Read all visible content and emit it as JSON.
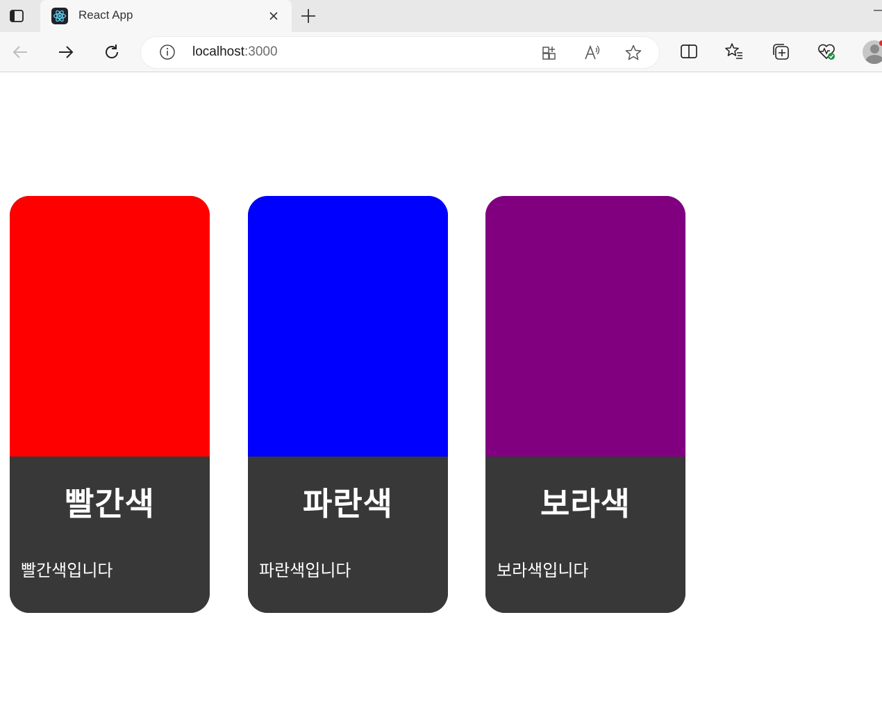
{
  "browser": {
    "tab": {
      "title": "React App",
      "favicon": "react-logo-icon"
    },
    "address": {
      "host": "localhost",
      "port": ":3000"
    },
    "icons": {
      "left": [
        "back-icon",
        "forward-icon",
        "refresh-icon"
      ],
      "address": [
        "site-info-icon",
        "apps-icon",
        "read-aloud-icon",
        "favorite-star-icon"
      ],
      "toolbar": [
        "split-screen-icon",
        "favorites-icon",
        "collections-icon",
        "browser-essentials-icon",
        "profile-icon"
      ]
    }
  },
  "cards": [
    {
      "color": "#ff0000",
      "title": "빨간색",
      "description": "빨간색입니다"
    },
    {
      "color": "#0000ff",
      "title": "파란색",
      "description": "파란색입니다"
    },
    {
      "color": "#800080",
      "title": "보라색",
      "description": "보라색입니다"
    }
  ]
}
